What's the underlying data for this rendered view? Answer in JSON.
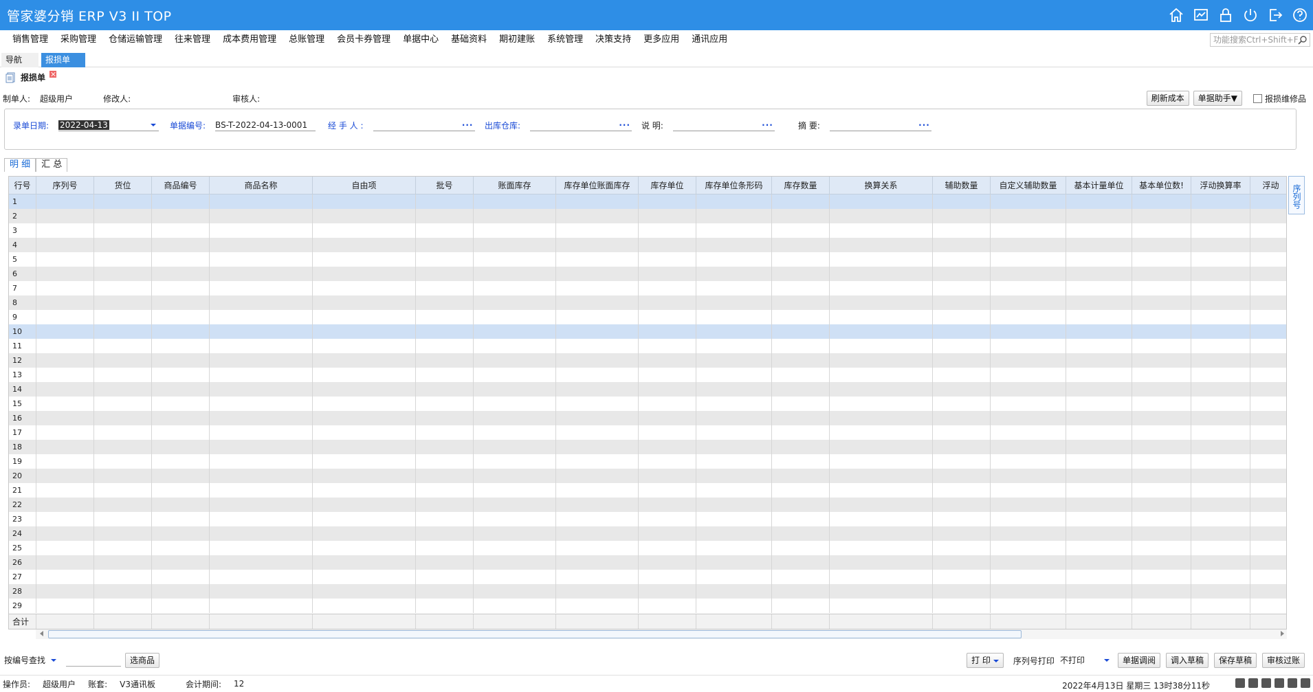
{
  "app": {
    "title": "管家婆分销 ERP V3 II TOP"
  },
  "title_icons": [
    "home-icon",
    "chart-icon",
    "lock-icon",
    "power-icon",
    "exit-icon",
    "help-icon"
  ],
  "menu": [
    "销售管理",
    "采购管理",
    "仓储运输管理",
    "往来管理",
    "成本费用管理",
    "总账管理",
    "会员卡券管理",
    "单据中心",
    "基础资料",
    "期初建账",
    "系统管理",
    "决策支持",
    "更多应用",
    "通讯应用"
  ],
  "func_search": {
    "placeholder": "功能搜索Ctrl+Shift+F"
  },
  "tabs": {
    "nav": "导航",
    "active": "报损单"
  },
  "doc": {
    "title": "报损单",
    "creator_label": "制单人:",
    "creator_value": "超级用户",
    "modifier_label": "修改人:",
    "modifier_value": "",
    "auditor_label": "审核人:",
    "auditor_value": ""
  },
  "tools": {
    "refresh_cost": "刷新成本",
    "helper": "单据助手▼",
    "repair_label": "报损维修品"
  },
  "form": {
    "date_label": "录单日期:",
    "date_value": "2022-04-13",
    "billno_label": "单据编号:",
    "billno_value": "BS-T-2022-04-13-0001",
    "handler_label": "经 手 人 :",
    "handler_value": "",
    "warehouse_label": "出库仓库:",
    "warehouse_value": "",
    "note_label": "说    明:",
    "note_value": "",
    "summary_label": "摘    要:",
    "summary_value": ""
  },
  "subtabs": [
    "明 细",
    "汇 总"
  ],
  "grid": {
    "columns": [
      "行号",
      "序列号",
      "货位",
      "商品编号",
      "商品名称",
      "自由项",
      "批号",
      "账面库存",
      "库存单位账面库存",
      "库存单位",
      "库存单位条形码",
      "库存数量",
      "换算关系",
      "辅助数量",
      "自定义辅助数量",
      "基本计量单位",
      "基本单位数!",
      "浮动换算率",
      "浮动"
    ],
    "rows": [
      "1",
      "2",
      "3",
      "4",
      "5",
      "6",
      "7",
      "8",
      "9",
      "10",
      "11",
      "12",
      "13",
      "14",
      "15",
      "16",
      "17",
      "18",
      "19",
      "20",
      "21",
      "22",
      "23",
      "24",
      "25",
      "26",
      "27",
      "28",
      "29"
    ],
    "selected_rows": [
      "1",
      "10"
    ],
    "footer_label": "合计"
  },
  "side_tab": "序列号",
  "bottom": {
    "search_mode": "按编号查找",
    "select_goods": "选商品",
    "print": "打 印",
    "serial_print_label": "序列号打印",
    "serial_print_value": "不打印",
    "buttons": [
      "单据调阅",
      "调入草稿",
      "保存草稿",
      "审核过账"
    ]
  },
  "status": {
    "operator_label": "操作员:",
    "operator_value": "超级用户",
    "account_label": "账套:",
    "account_value": "V3通讯板",
    "period_label": "会计期间:",
    "period_value": "12",
    "datetime": "2022年4月13日  星期三  13时38分11秒"
  }
}
